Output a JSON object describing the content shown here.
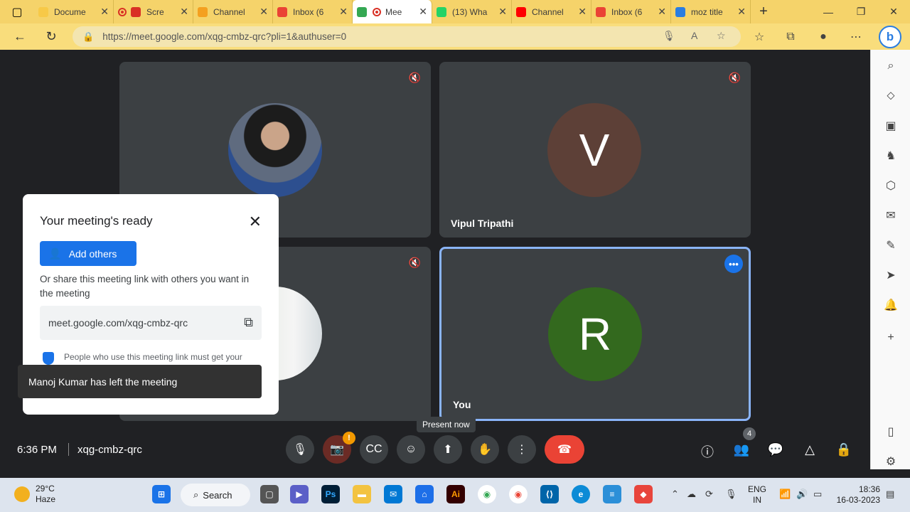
{
  "browser": {
    "tabs": [
      {
        "title": "Docume",
        "color": "#f7c948",
        "active": false
      },
      {
        "title": "Scre",
        "color": "#d93025",
        "active": false,
        "recording": true
      },
      {
        "title": "Channel",
        "color": "#f4a020",
        "active": false
      },
      {
        "title": "Inbox (6",
        "color": "#ea4335",
        "active": false
      },
      {
        "title": "Mee",
        "color": "#34a853",
        "active": true,
        "recording": true
      },
      {
        "title": "(13) Wha",
        "color": "#25d366",
        "active": false
      },
      {
        "title": "Channel",
        "color": "#ff0000",
        "active": false
      },
      {
        "title": "Inbox (6",
        "color": "#ea4335",
        "active": false
      },
      {
        "title": "moz title",
        "color": "#2a7de1",
        "active": false
      }
    ],
    "url": "https://meet.google.com/xqg-cmbz-qrc?pli=1&authuser=0"
  },
  "tiles": {
    "tile1": {
      "name": ""
    },
    "tile2": {
      "name": "Vipul Tripathi",
      "initial": "V",
      "color": "#5d4037"
    },
    "tile3": {
      "name": ""
    },
    "tile4": {
      "name": "You",
      "initial": "R",
      "color": "#33691e"
    }
  },
  "panel": {
    "heading": "Your meeting's ready",
    "add_others": "Add others",
    "share_text": "Or share this meeting link with others you want in the meeting",
    "link": "meet.google.com/xqg-cmbz-qrc",
    "note": "People who use this meeting link must get your"
  },
  "toast": "Manoj Kumar has left the meeting",
  "controls": {
    "time": "6:36 PM",
    "code": "xqg-cmbz-qrc",
    "tooltip": "Present now",
    "people_count": "4",
    "camera_alert": "!"
  },
  "taskbar": {
    "temp": "29°C",
    "weather": "Haze",
    "search": "Search",
    "lang1": "ENG",
    "lang2": "IN",
    "time": "18:36",
    "date": "16-03-2023"
  }
}
